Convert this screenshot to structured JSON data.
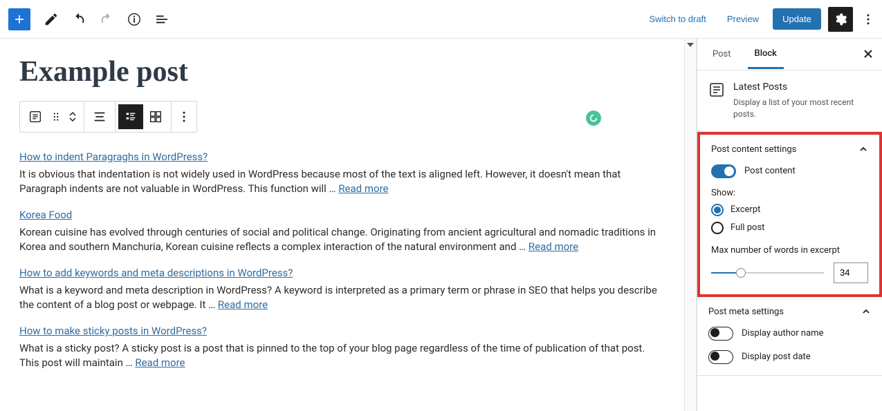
{
  "toolbar": {
    "switch_to_draft": "Switch to draft",
    "preview": "Preview",
    "update": "Update"
  },
  "page_title": "Example post",
  "posts": [
    {
      "title": "How to indent Paragraghs in WordPress?",
      "excerpt": "It is obvious that indentation is not widely used in WordPress because most of the text is aligned left. However, it doesn't mean that Paragraph indents are not valuable in WordPress. This function will …",
      "read_more": "Read more"
    },
    {
      "title": "Korea Food",
      "excerpt": "Korean cuisine has evolved through centuries of social and political change. Originating from ancient agricultural and nomadic traditions in Korea and southern Manchuria, Korean cuisine reflects a complex interaction of the natural environment and …",
      "read_more": "Read more"
    },
    {
      "title": "How to add keywords and meta descriptions in WordPress?",
      "excerpt": "What is a keyword and meta description in WordPress? A keyword is interpreted as a primary term or phrase in SEO that helps you describe the content of a blog post or webpage. It …",
      "read_more": "Read more"
    },
    {
      "title": "How to make sticky posts in WordPress?",
      "excerpt": "What is a sticky post? A sticky post is a post that is pinned to the top of your blog page regardless of the time of publication of that post. This post will maintain …",
      "read_more": "Read more"
    }
  ],
  "sidebar": {
    "tabs": {
      "post": "Post",
      "block": "Block"
    },
    "block_info": {
      "title": "Latest Posts",
      "desc": "Display a list of your most recent posts."
    },
    "content_settings": {
      "title": "Post content settings",
      "post_content_label": "Post content",
      "show_label": "Show:",
      "option_excerpt": "Excerpt",
      "option_full": "Full post",
      "max_words_label": "Max number of words in excerpt",
      "max_words_value": "34"
    },
    "meta_settings": {
      "title": "Post meta settings",
      "display_author": "Display author name",
      "display_date": "Display post date"
    }
  }
}
